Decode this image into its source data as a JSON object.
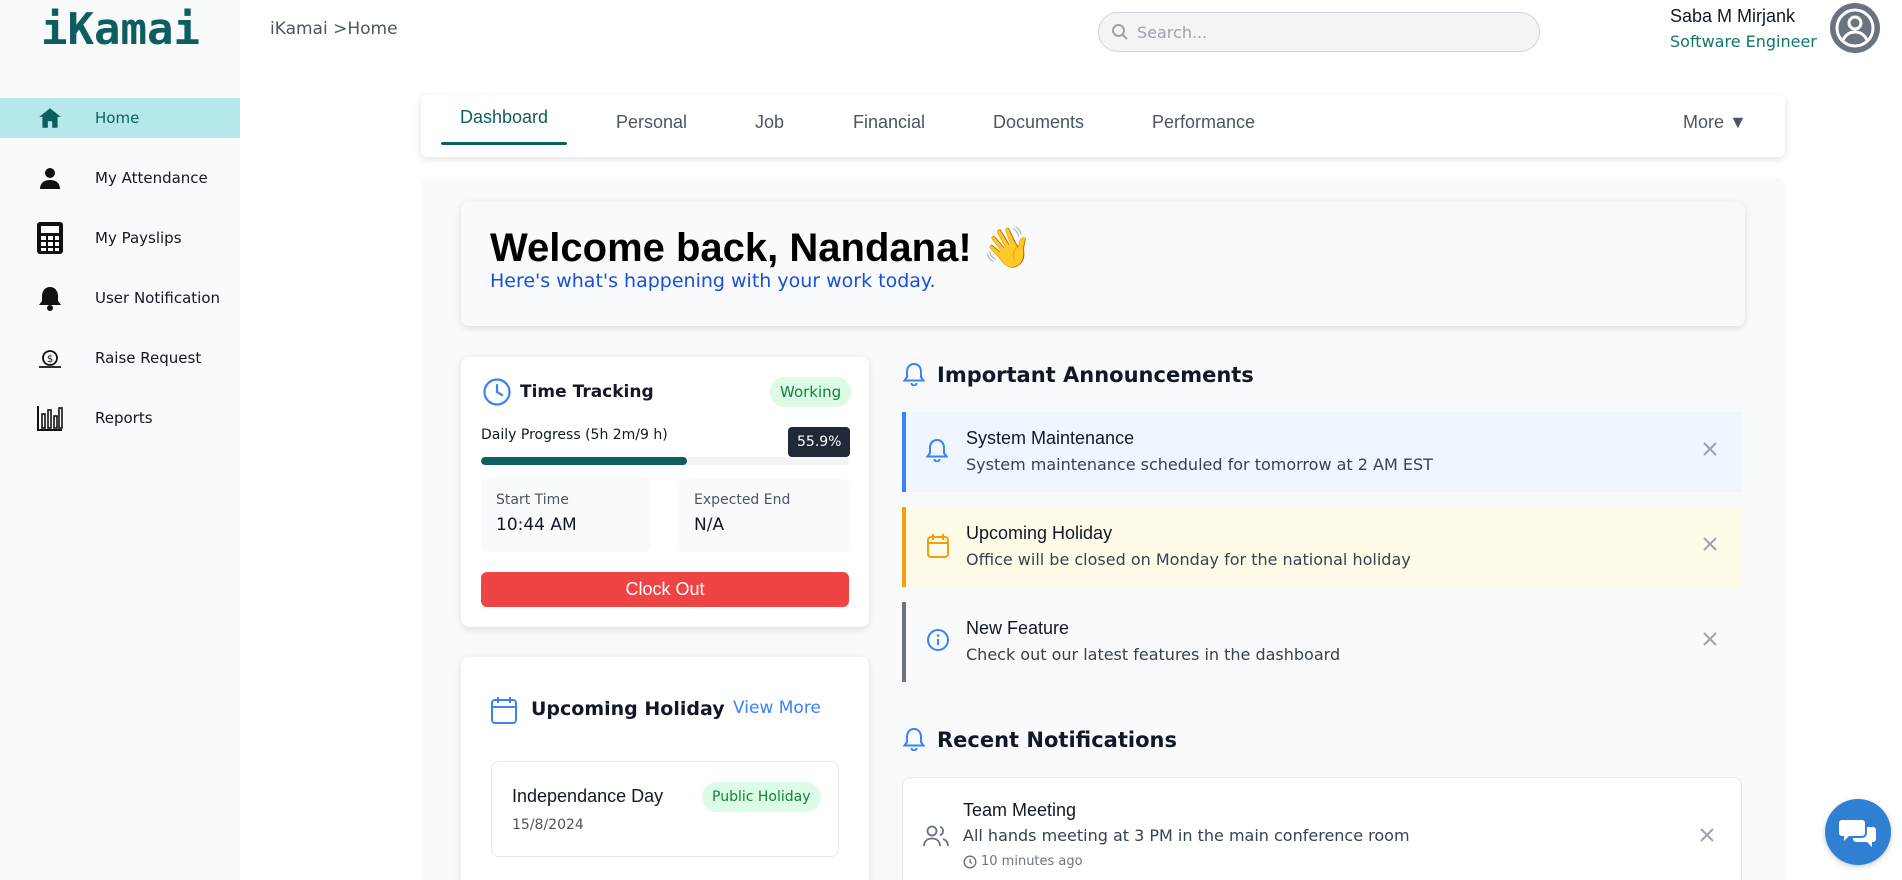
{
  "app": {
    "logo": "iKamai"
  },
  "breadcrumb": "iKamai >Home",
  "search": {
    "placeholder": "Search..."
  },
  "user": {
    "name": "Saba M Mirjank",
    "role": "Software Engineer"
  },
  "sidebar": {
    "items": [
      {
        "label": "Home",
        "icon": "home-icon",
        "active": true
      },
      {
        "label": "My Attendance",
        "icon": "person-icon"
      },
      {
        "label": "My Payslips",
        "icon": "calculator-icon"
      },
      {
        "label": "User Notification",
        "icon": "bell-icon"
      },
      {
        "label": "Raise Request",
        "icon": "money-request-icon"
      },
      {
        "label": "Reports",
        "icon": "bar-chart-icon"
      }
    ]
  },
  "tabs": {
    "items": [
      {
        "label": "Dashboard",
        "active": true
      },
      {
        "label": "Personal"
      },
      {
        "label": "Job"
      },
      {
        "label": "Financial"
      },
      {
        "label": "Documents"
      },
      {
        "label": "Performance"
      }
    ],
    "more": "More ▼"
  },
  "welcome": {
    "title": "Welcome back, Nandana! 👋",
    "subtitle": "Here's what's happening with your work today."
  },
  "time_tracking": {
    "title": "Time Tracking",
    "status": "Working",
    "progress_label": "Daily Progress (5h 2m/9 h)",
    "progress_percent": 55.9,
    "progress_text": "55.9%",
    "start_label": "Start Time",
    "start_value": "10:44 AM",
    "end_label": "Expected End",
    "end_value": "N/A",
    "clock_out": "Clock Out"
  },
  "upcoming_holiday": {
    "title": "Upcoming Holiday",
    "view_more": "View More",
    "item": {
      "name": "Independance Day",
      "type": "Public Holiday",
      "date": "15/8/2024"
    }
  },
  "announcements": {
    "title": "Important Announcements",
    "items": [
      {
        "title": "System Maintenance",
        "message": "System maintenance scheduled for tomorrow at 2 AM EST",
        "color": "#3b82f6",
        "bg": "#eff6ff",
        "icon": "bell-icon"
      },
      {
        "title": "Upcoming Holiday",
        "message": "Office will be closed on Monday for the national holiday",
        "color": "#f59e0b",
        "bg": "#fefce8",
        "icon": "calendar-icon"
      },
      {
        "title": "New Feature",
        "message": "Check out our latest features in the dashboard",
        "color": "#6b7280",
        "bg": "#f8fafc",
        "icon": "info-icon"
      }
    ]
  },
  "notifications": {
    "title": "Recent Notifications",
    "items": [
      {
        "title": "Team Meeting",
        "message": "All hands meeting at 3 PM in the main conference room",
        "time": "10 minutes ago",
        "icon": "users-icon"
      }
    ]
  },
  "colors": {
    "brand": "#0f5e5f",
    "accent": "#3b82f6",
    "danger": "#ef4444"
  }
}
